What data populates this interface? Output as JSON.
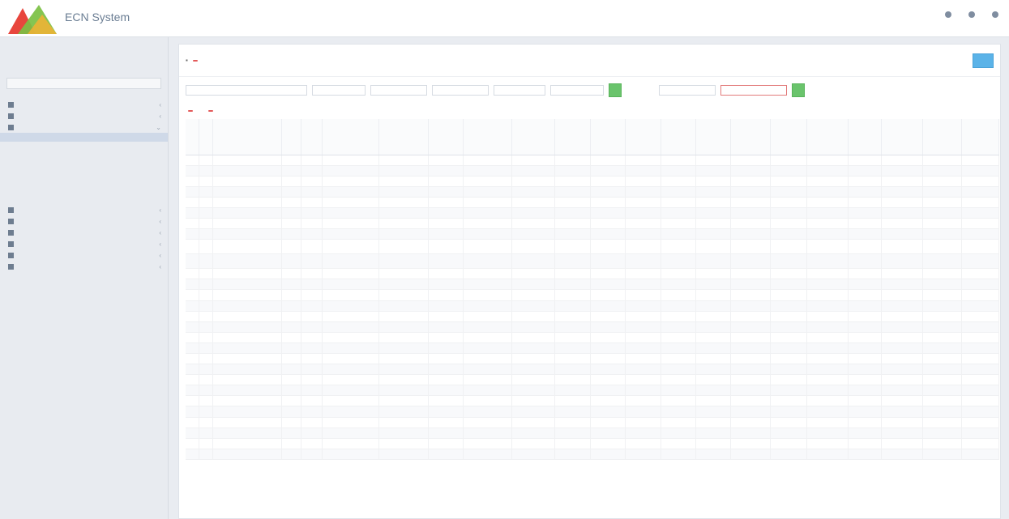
{
  "app": {
    "title": "ECN System"
  },
  "header": {
    "items": [
      "",
      "",
      ""
    ]
  },
  "sidebar": {
    "tabs": [
      "",
      "",
      ""
    ],
    "items": [
      {
        "label": "",
        "expanded": false
      },
      {
        "label": "",
        "expanded": false
      },
      {
        "label": "",
        "expanded": true
      }
    ],
    "subitems": [
      "",
      "",
      "",
      "",
      "",
      "",
      "",
      ""
    ],
    "items_after": [
      "",
      "",
      "",
      "",
      "",
      ""
    ]
  },
  "toolbar": {
    "breadcrumb": "",
    "badge": "",
    "options": [
      "",
      ""
    ],
    "primary_button": ""
  },
  "filters": {
    "search_button": "",
    "right_button": ""
  },
  "subtabs": [
    "",
    ""
  ],
  "table": {
    "columns": 22,
    "rows": 28
  }
}
